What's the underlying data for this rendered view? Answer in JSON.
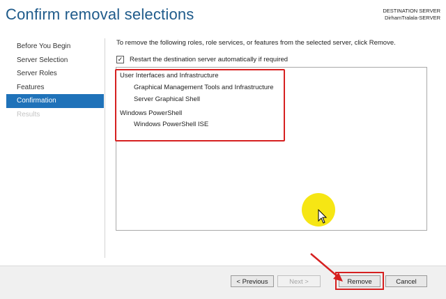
{
  "header": {
    "title": "Confirm removal selections",
    "destination_label": "DESTINATION SERVER",
    "destination_server": "DirhamTralala-SERVER"
  },
  "nav": {
    "items": [
      {
        "label": "Before You Begin",
        "state": "normal"
      },
      {
        "label": "Server Selection",
        "state": "normal"
      },
      {
        "label": "Server Roles",
        "state": "normal"
      },
      {
        "label": "Features",
        "state": "normal"
      },
      {
        "label": "Confirmation",
        "state": "active"
      },
      {
        "label": "Results",
        "state": "disabled"
      }
    ]
  },
  "main": {
    "intro": "To remove the following roles, role services, or features from the selected server, click Remove.",
    "restart_checkbox": {
      "label": "Restart the destination server automatically if required",
      "checked": true,
      "mark": "✓"
    },
    "removal_list": [
      {
        "name": "User Interfaces and Infrastructure",
        "children": [
          "Graphical Management Tools and Infrastructure",
          "Server Graphical Shell"
        ]
      },
      {
        "name": "Windows PowerShell",
        "children": [
          "Windows PowerShell ISE"
        ]
      }
    ]
  },
  "footer": {
    "previous_label": "< Previous",
    "next_label": "Next >",
    "remove_label": "Remove",
    "cancel_label": "Cancel"
  },
  "colors": {
    "title": "#1e5a8a",
    "nav_active": "#1f72b9",
    "annotation_red": "#d62020",
    "cursor_highlight": "#f5e400"
  }
}
